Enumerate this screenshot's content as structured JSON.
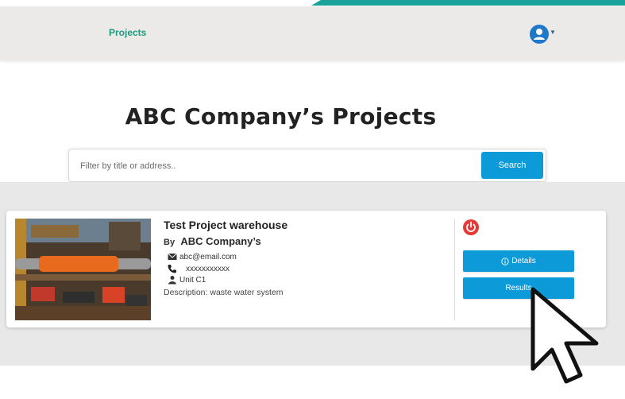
{
  "nav": {
    "projects_label": "Projects"
  },
  "icons": {
    "user": "user-avatar-icon",
    "caret": "caret-down-icon",
    "power": "power-icon",
    "email": "email-icon",
    "phone": "phone-icon",
    "person": "person-icon",
    "info": "info-icon",
    "cursor": "mouse-pointer-icon"
  },
  "colors": {
    "accent_blue": "#0d9ad8",
    "nav_link_green": "#1a9b7c",
    "teal_strip": "#1aa39b",
    "power_red": "#e53935"
  },
  "page": {
    "title": "ABC Company’s Projects"
  },
  "search": {
    "placeholder": "Filter by title or address..",
    "button_label": "Search"
  },
  "project": {
    "title": "Test Project warehouse",
    "by_label": "By",
    "company": "ABC Company’s",
    "email": "abc@email.com",
    "phone": "xxxxxxxxxxx",
    "unit": "Unit C1",
    "description": "Description: waste water system",
    "details_label": "Details",
    "results_label": "Results"
  }
}
